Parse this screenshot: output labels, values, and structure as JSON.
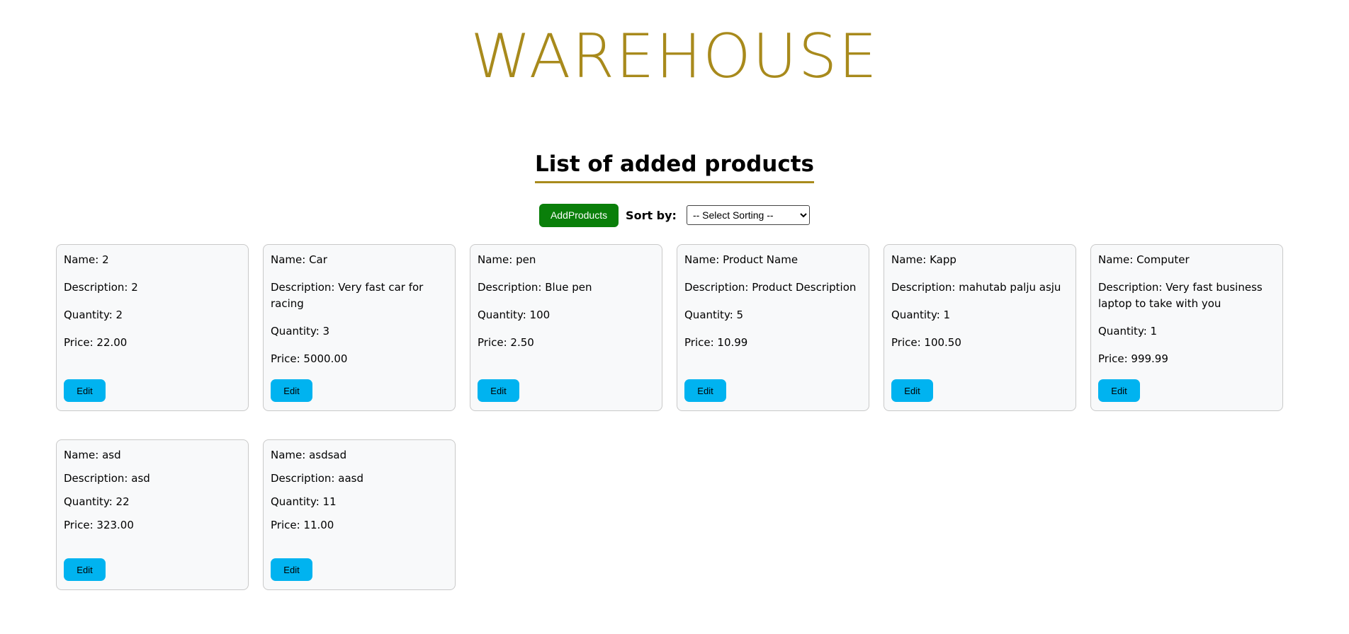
{
  "header": {
    "title": "WAREHOUSE"
  },
  "section": {
    "title": "List of added products"
  },
  "controls": {
    "add_label": "AddProducts",
    "sort_label": "Sort by:",
    "sort_selected": "-- Select Sorting --"
  },
  "products": [
    {
      "name": "Name: 2",
      "description": "Description: 2",
      "quantity": "Quantity: 2",
      "price": "Price: 22.00",
      "edit_label": "Edit"
    },
    {
      "name": "Name: Car",
      "description": "Description: Very fast car for racing",
      "quantity": "Quantity: 3",
      "price": "Price: 5000.00",
      "edit_label": "Edit"
    },
    {
      "name": "Name: pen",
      "description": "Description: Blue pen",
      "quantity": "Quantity: 100",
      "price": "Price: 2.50",
      "edit_label": "Edit"
    },
    {
      "name": "Name: Product Name",
      "description": "Description: Product Description",
      "quantity": "Quantity: 5",
      "price": "Price: 10.99",
      "edit_label": "Edit"
    },
    {
      "name": "Name: Kapp",
      "description": "Description: mahutab palju asju",
      "quantity": "Quantity: 1",
      "price": "Price: 100.50",
      "edit_label": "Edit"
    },
    {
      "name": "Name: Computer",
      "description": "Description: Very fast business laptop to take with you",
      "quantity": "Quantity: 1",
      "price": "Price: 999.99",
      "edit_label": "Edit"
    },
    {
      "name": "Name: asd",
      "description": "Description: asd",
      "quantity": "Quantity: 22",
      "price": "Price: 323.00",
      "edit_label": "Edit"
    },
    {
      "name": "Name: asdsad",
      "description": "Description: aasd",
      "quantity": "Quantity: 11",
      "price": "Price: 11.00",
      "edit_label": "Edit"
    }
  ],
  "colors": {
    "title": "#a88a1c",
    "add_button": "#0a7f0a",
    "edit_button": "#00b3f0",
    "card_background": "#f8f9fa"
  }
}
